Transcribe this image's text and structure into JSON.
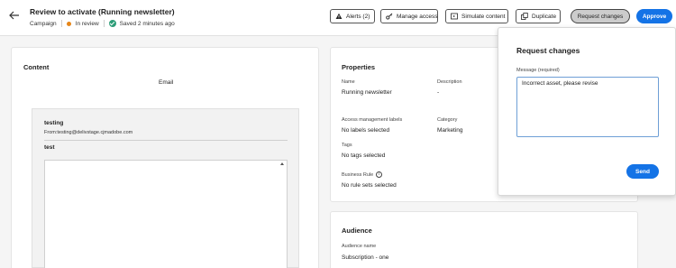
{
  "header": {
    "title": "Review to activate (Running newsletter)",
    "type": "Campaign",
    "status": "In review",
    "saved": "Saved 2 minutes ago",
    "buttons": {
      "alerts": "Alerts (2)",
      "manage_access": "Manage access",
      "simulate": "Simulate content",
      "duplicate": "Duplicate",
      "request_changes": "Request changes",
      "approve": "Approve"
    }
  },
  "content": {
    "title": "Content",
    "channel": "Email",
    "from_name": "testing",
    "from_address": "From:testing@delivstage.cjmadobe.com",
    "subject": "test"
  },
  "properties": {
    "title": "Properties",
    "name_label": "Name",
    "name_value": "Running newsletter",
    "description_label": "Description",
    "description_value": "-",
    "access_label": "Access management labels",
    "access_value": "No labels selected",
    "category_label": "Category",
    "category_value": "Marketing",
    "tags_label": "Tags",
    "tags_value": "No tags selected",
    "rule_label": "Business Rule",
    "rule_value": "No rule sets selected"
  },
  "audience": {
    "title": "Audience",
    "name_label": "Audience name",
    "name_value": "Subscription - one"
  },
  "popover": {
    "title": "Request changes",
    "message_label": "Message (required)",
    "message_value": "Incorrect asset, please revise",
    "send": "Send"
  },
  "colors": {
    "accent": "#1473e6",
    "in_review": "#e68619",
    "saved_ok": "#2d9d78"
  }
}
